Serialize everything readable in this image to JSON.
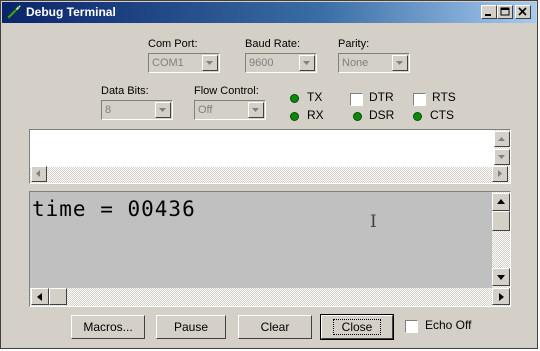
{
  "window": {
    "title": "Debug Terminal"
  },
  "settings": {
    "com_port": {
      "label": "Com Port:",
      "value": "COM1"
    },
    "baud_rate": {
      "label": "Baud Rate:",
      "value": "9600"
    },
    "parity": {
      "label": "Parity:",
      "value": "None"
    },
    "data_bits": {
      "label": "Data Bits:",
      "value": "8"
    },
    "flow_control": {
      "label": "Flow Control:",
      "value": "Off"
    }
  },
  "indicators": {
    "tx": "TX",
    "rx": "RX",
    "dsr": "DSR",
    "cts": "CTS",
    "led_color": "#0a8a0a"
  },
  "lines": {
    "dtr": "DTR",
    "rts": "RTS"
  },
  "terminal": {
    "text": "time = 00436",
    "cursor": "I"
  },
  "buttons": {
    "macros": "Macros...",
    "pause": "Pause",
    "clear": "Clear",
    "close": "Close"
  },
  "echo_off": "Echo Off",
  "accent": "#0a246a"
}
